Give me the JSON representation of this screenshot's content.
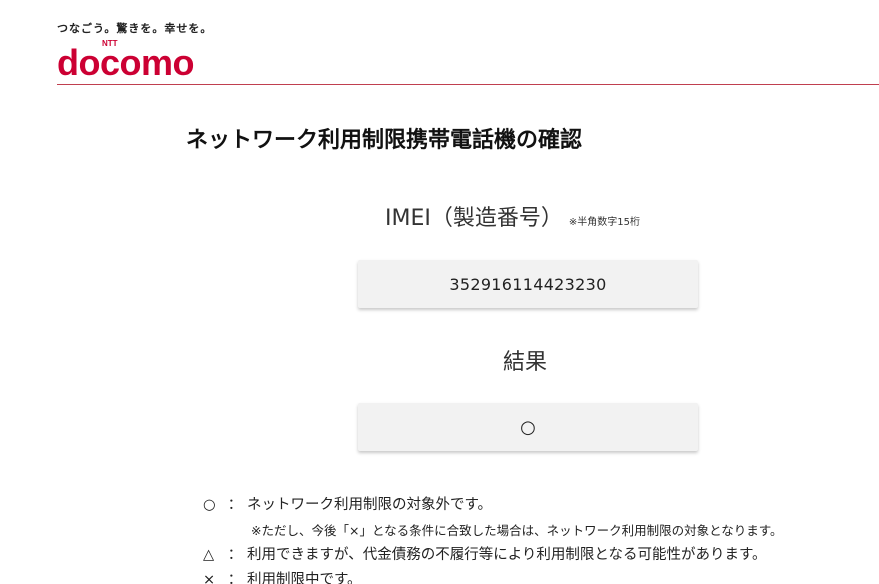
{
  "header": {
    "tagline": "つなごう。驚きを。幸せを。",
    "logo_text": "docomo",
    "logo_super": "NTT",
    "brand_color": "#cc0033"
  },
  "main": {
    "title": "ネットワーク利用制限携帯電話機の確認",
    "imei_label": "IMEI（製造番号）",
    "imei_note": "※半角数字15桁",
    "imei_value": "352916114423230",
    "result_label": "結果",
    "result_value": "○"
  },
  "legend": [
    {
      "symbol": "○",
      "colon": "：",
      "text": "ネットワーク利用制限の対象外です。"
    },
    {
      "note": "※ただし、今後「×」となる条件に合致した場合は、ネットワーク利用制限の対象となります。"
    },
    {
      "symbol": "△",
      "colon": "：",
      "text": "利用できますが、代金債務の不履行等により利用制限となる可能性があります。"
    },
    {
      "symbol": "×",
      "colon": "：",
      "text": "利用制限中です。"
    }
  ]
}
